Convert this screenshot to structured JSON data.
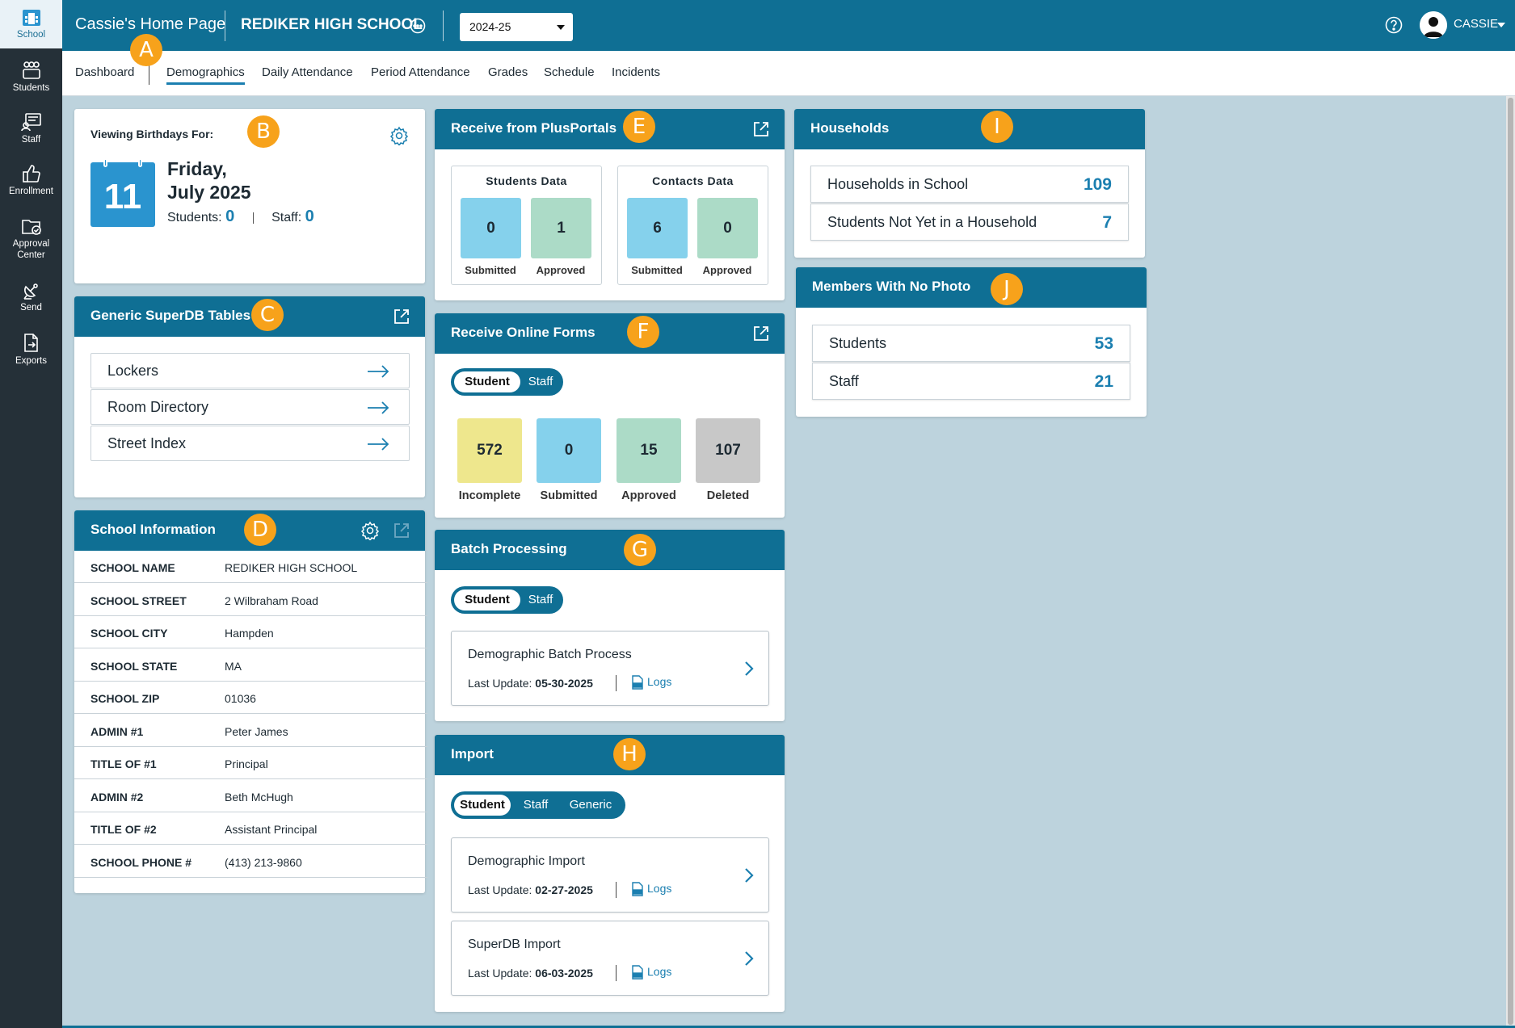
{
  "rail": {
    "items": [
      {
        "label": "School",
        "icon": "school-icon"
      },
      {
        "label": "Students",
        "icon": "students-icon"
      },
      {
        "label": "Staff",
        "icon": "staff-icon"
      },
      {
        "label": "Enrollment",
        "icon": "thumbs-up-icon"
      },
      {
        "label": "Approval",
        "label2": "Center",
        "icon": "folder-check-icon"
      },
      {
        "label": "Send",
        "icon": "satellite-icon"
      },
      {
        "label": "Exports",
        "icon": "export-file-icon"
      }
    ]
  },
  "header": {
    "title": "Cassie's Home Page",
    "school": "REDIKER HIGH SCHOOL",
    "year": "2024-25",
    "user": "CASSIE"
  },
  "nav": {
    "tabs": [
      "Dashboard",
      "Demographics",
      "Daily Attendance",
      "Period Attendance",
      "Grades",
      "Schedule",
      "Incidents"
    ]
  },
  "badges": [
    "A",
    "B",
    "C",
    "D",
    "E",
    "F",
    "G",
    "H",
    "I",
    "J"
  ],
  "birthdays": {
    "label": "Viewing Birthdays For:",
    "day": "11",
    "weekday": "Friday,",
    "month_year": "July 2025",
    "students_label": "Students:",
    "students": "0",
    "staff_label": "Staff:",
    "staff": "0"
  },
  "superdb": {
    "title": "Generic SuperDB Tables",
    "items": [
      "Lockers",
      "Room Directory",
      "Street Index"
    ]
  },
  "school_info": {
    "title": "School Information",
    "rows": [
      {
        "key": "SCHOOL NAME",
        "value": "REDIKER HIGH SCHOOL"
      },
      {
        "key": "SCHOOL STREET",
        "value": "2 Wilbraham Road"
      },
      {
        "key": "SCHOOL CITY",
        "value": "Hampden"
      },
      {
        "key": "SCHOOL STATE",
        "value": "MA"
      },
      {
        "key": "SCHOOL ZIP",
        "value": "01036"
      },
      {
        "key": "ADMIN #1",
        "value": "Peter James"
      },
      {
        "key": "TITLE OF #1",
        "value": "Principal"
      },
      {
        "key": "ADMIN #2",
        "value": "Beth McHugh"
      },
      {
        "key": "TITLE OF #2",
        "value": "Assistant Principal"
      },
      {
        "key": "SCHOOL PHONE #",
        "value": "(413) 213-9860"
      }
    ]
  },
  "plusportals": {
    "title": "Receive from PlusPortals",
    "students": {
      "title": "Students Data",
      "submitted": "0",
      "approved": "1"
    },
    "contacts": {
      "title": "Contacts Data",
      "submitted": "6",
      "approved": "0"
    },
    "submitted_label": "Submitted",
    "approved_label": "Approved"
  },
  "online_forms": {
    "title": "Receive Online Forms",
    "toggle": [
      "Student",
      "Staff"
    ],
    "tiles": [
      {
        "value": "572",
        "label": "Incomplete"
      },
      {
        "value": "0",
        "label": "Submitted"
      },
      {
        "value": "15",
        "label": "Approved"
      },
      {
        "value": "107",
        "label": "Deleted"
      }
    ]
  },
  "batch": {
    "title": "Batch Processing",
    "toggle": [
      "Student",
      "Staff"
    ],
    "items": [
      {
        "name": "Demographic Batch Process",
        "date_label": "Last Update:",
        "date": "05-30-2025",
        "logs": "Logs"
      }
    ]
  },
  "import": {
    "title": "Import",
    "toggle": [
      "Student",
      "Staff",
      "Generic"
    ],
    "items": [
      {
        "name": "Demographic Import",
        "date_label": "Last Update:",
        "date": "02-27-2025",
        "logs": "Logs"
      },
      {
        "name": "SuperDB Import",
        "date_label": "Last Update:",
        "date": "06-03-2025",
        "logs": "Logs"
      }
    ]
  },
  "households": {
    "title": "Households",
    "rows": [
      {
        "label": "Households in School",
        "value": "109"
      },
      {
        "label": "Students Not Yet in a Household",
        "value": "7"
      }
    ]
  },
  "no_photo": {
    "title": "Members With No Photo",
    "rows": [
      {
        "label": "Students",
        "value": "53"
      },
      {
        "label": "Staff",
        "value": "21"
      }
    ]
  },
  "colors": {
    "primary": "#0f6f94",
    "accent": "#1b7fb0",
    "badge": "#f7a21b",
    "background": "#bdd3dd"
  }
}
